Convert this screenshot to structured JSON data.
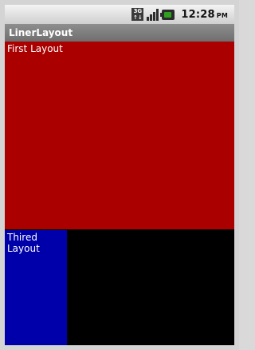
{
  "status_bar": {
    "network_label_top": "3G",
    "network_label_bottom": "↑↓",
    "time": "12:28",
    "ampm": "PM",
    "icons": [
      "3g-icon",
      "signal-icon",
      "battery-icon"
    ],
    "battery_color": "#2ea01e"
  },
  "app": {
    "title": "LinerLayout"
  },
  "layouts": {
    "first": {
      "label": "First Layout",
      "color": "#aa0000"
    },
    "third": {
      "label": "Thired Layout",
      "color": "#0000aa"
    },
    "rest": {
      "color": "#000000"
    }
  }
}
